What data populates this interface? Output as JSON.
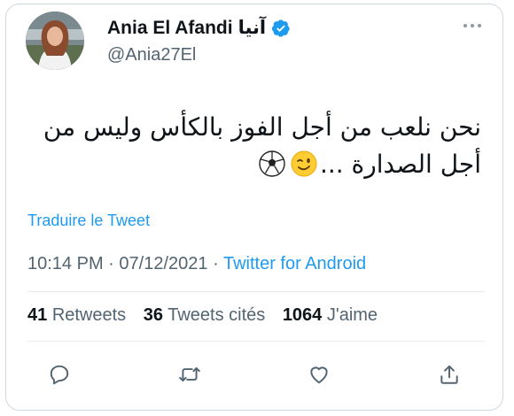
{
  "author": {
    "name_latin": "Ania El Afandi",
    "name_arabic": "آنيا",
    "handle": "@Ania27El",
    "verified": true
  },
  "tweet": {
    "line1": "نحن نلعب من أجل الفوز بالكأس وليس من",
    "line2": "أجل الصدارة ..."
  },
  "translate_label": "Traduire le Tweet",
  "meta": {
    "time": "10:14 PM",
    "separator": "·",
    "date": "07/12/2021",
    "source": "Twitter for Android"
  },
  "stats": {
    "retweets_count": "41",
    "retweets_label": "Retweets",
    "quotes_count": "36",
    "quotes_label": "Tweets cités",
    "likes_count": "1064",
    "likes_label": "J'aime"
  },
  "icons": {
    "more": "more-horizontal-icon",
    "verified": "verified-badge-icon",
    "reply": "reply-icon",
    "retweet": "retweet-icon",
    "like": "heart-icon",
    "share": "share-icon",
    "emoji1": "winking-face-emoji",
    "emoji2": "soccer-ball-emoji"
  },
  "colors": {
    "accent": "#1d9bf0",
    "text": "#0f1419",
    "muted": "#536471",
    "border": "#cfd9de"
  }
}
